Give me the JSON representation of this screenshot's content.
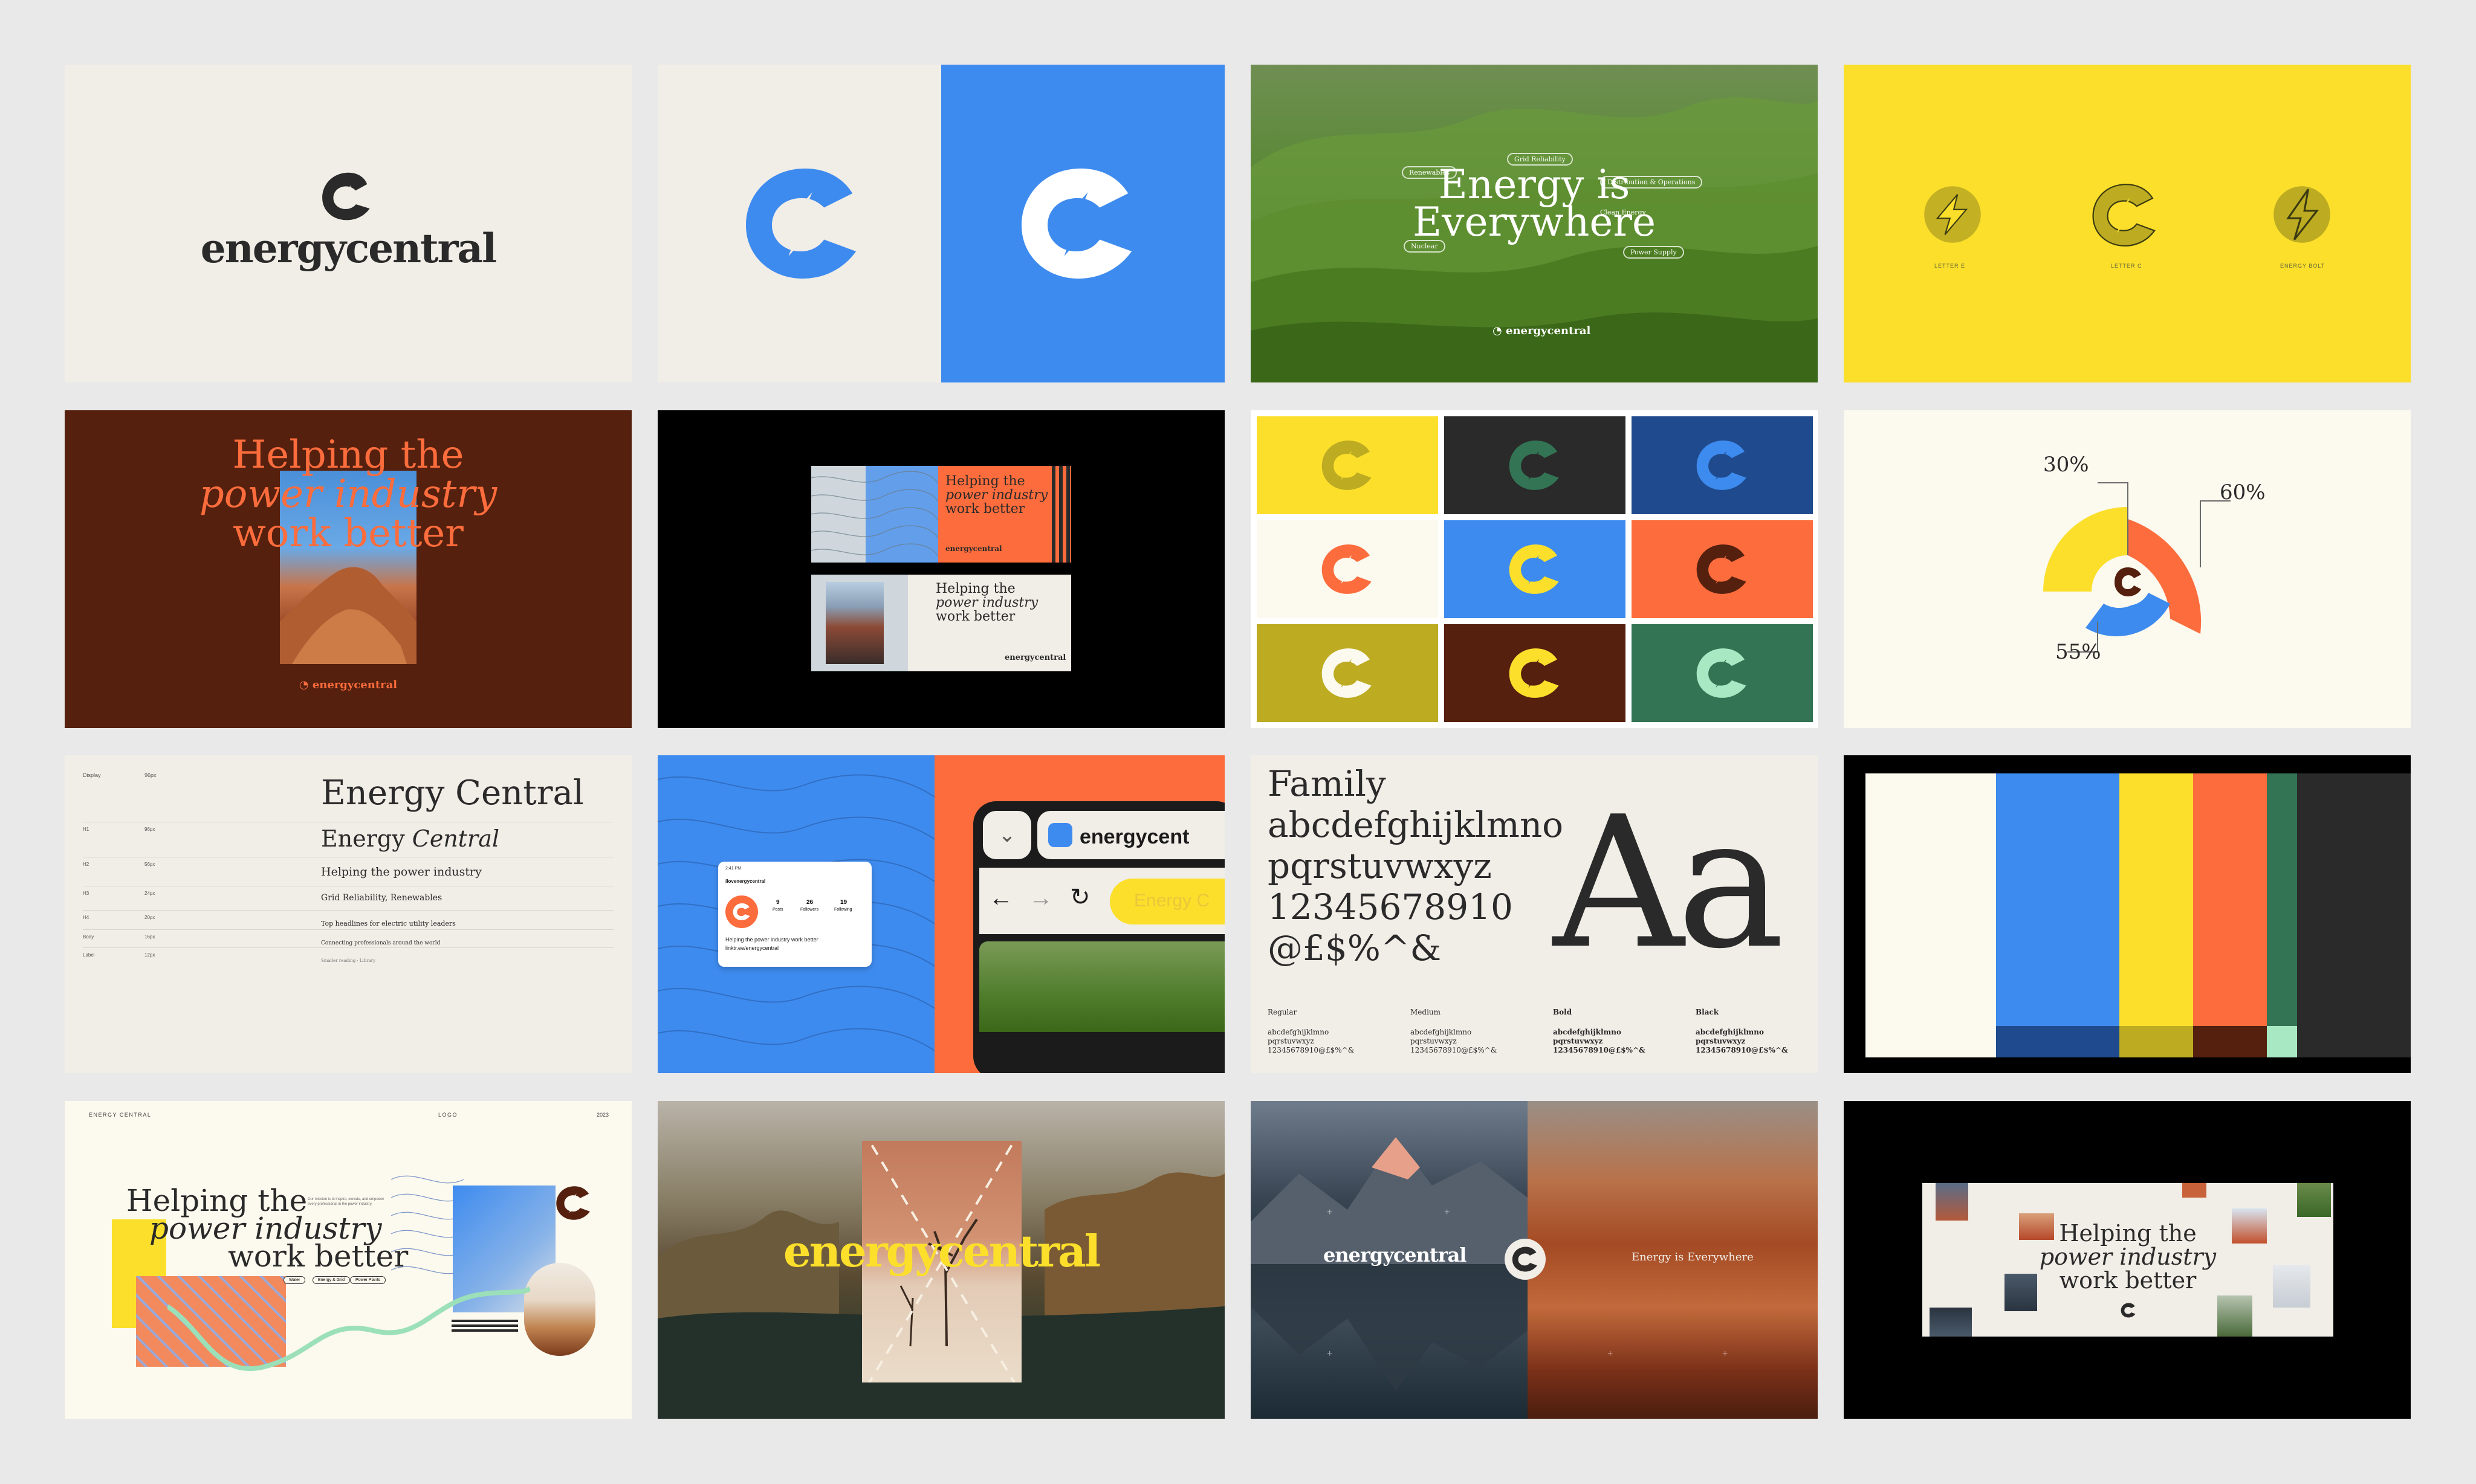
{
  "brand": {
    "name": "energycentral",
    "name_full": "Energy Central"
  },
  "colors": {
    "cream": "#f1ede7",
    "blue": "#3e8bef",
    "yellow": "#fbdf2b",
    "orange": "#fc6c3c",
    "maroon": "#55200e",
    "olive": "#bdab22",
    "green": "#337454",
    "dark": "#2a2a2a",
    "navy": "#1f4b8e",
    "mint": "#a8e8c2",
    "ivory": "#fcf9ee"
  },
  "hero_tile": {
    "title_line1": "Energy is",
    "title_line2": "Everywhere",
    "tags": [
      "Renewables",
      "Grid Reliability",
      "Distribution & Operations",
      "Clean Energy",
      "Nuclear",
      "Power Supply"
    ]
  },
  "glyphs_tile": {
    "labels": [
      "LETTER E",
      "LETTER C",
      "ENERGY BOLT"
    ]
  },
  "tagline": {
    "line1": "Helping the",
    "line2": "power industry",
    "line3": "work better"
  },
  "chart_tile": {
    "values": [
      "30%",
      "60%",
      "55%"
    ]
  },
  "type_scale": {
    "header_col1": "Display",
    "header_col2": "96px",
    "rows": [
      {
        "label": "H1",
        "size": "96px"
      },
      {
        "label": "H2",
        "size": "56px"
      },
      {
        "label": "H3",
        "size": "24px"
      },
      {
        "label": "H4",
        "size": "20px"
      },
      {
        "label": "Body",
        "size": "16px"
      },
      {
        "label": "Label",
        "size": "12px"
      }
    ],
    "samples": [
      "Energy Central",
      "Energy Central",
      "Helping the power industry",
      "Grid Reliability, Renewables",
      "Top headlines for electric utility leaders",
      "Connecting professionals around the world"
    ],
    "italic_part": "Central",
    "caption": "Smaller reading · Library"
  },
  "social_tile": {
    "time": "2:41 PM",
    "handle": "ilovenergycentral",
    "stats": [
      {
        "n": "9",
        "l": "Posts"
      },
      {
        "n": "26",
        "l": "Followers"
      },
      {
        "n": "19",
        "l": "Following"
      }
    ],
    "bio": "Helping the power industry work better",
    "link": "linktr.ee/energycentral",
    "browser_text": "energycent",
    "browser_cta": "Energy C"
  },
  "typeface_tile": {
    "lines": [
      "Family",
      "abcdefghijklmno",
      "pqrstuvwxyz",
      "12345678910",
      "@£$%^&"
    ],
    "specimen": "Aa",
    "weights": [
      {
        "name": "Regular",
        "a": "abcdefghijklmno",
        "b": "pqrstuvwxyz",
        "c": "12345678910@£$%^&"
      },
      {
        "name": "Medium",
        "a": "abcdefghijklmno",
        "b": "pqrstuvwxyz",
        "c": "12345678910@£$%^&"
      },
      {
        "name": "Bold",
        "a": "abcdefghijklmno",
        "b": "pqrstuvwxyz",
        "c": "12345678910@£$%^&"
      },
      {
        "name": "Black",
        "a": "abcdefghijklmno",
        "b": "pqrstuvwxyz",
        "c": "12345678910@£$%^&"
      }
    ]
  },
  "website_tile": {
    "nav_left": "ENERGY CENTRAL",
    "nav_mid": "LOGO",
    "nav_right": "2023",
    "chips": [
      "Water",
      "Energy & Grid",
      "Power Plants"
    ],
    "note": "Our mission is to inspire, elevate, and empower every professional in the power industry."
  },
  "mountain_tile": {
    "right_text": "Energy is Everywhere"
  }
}
